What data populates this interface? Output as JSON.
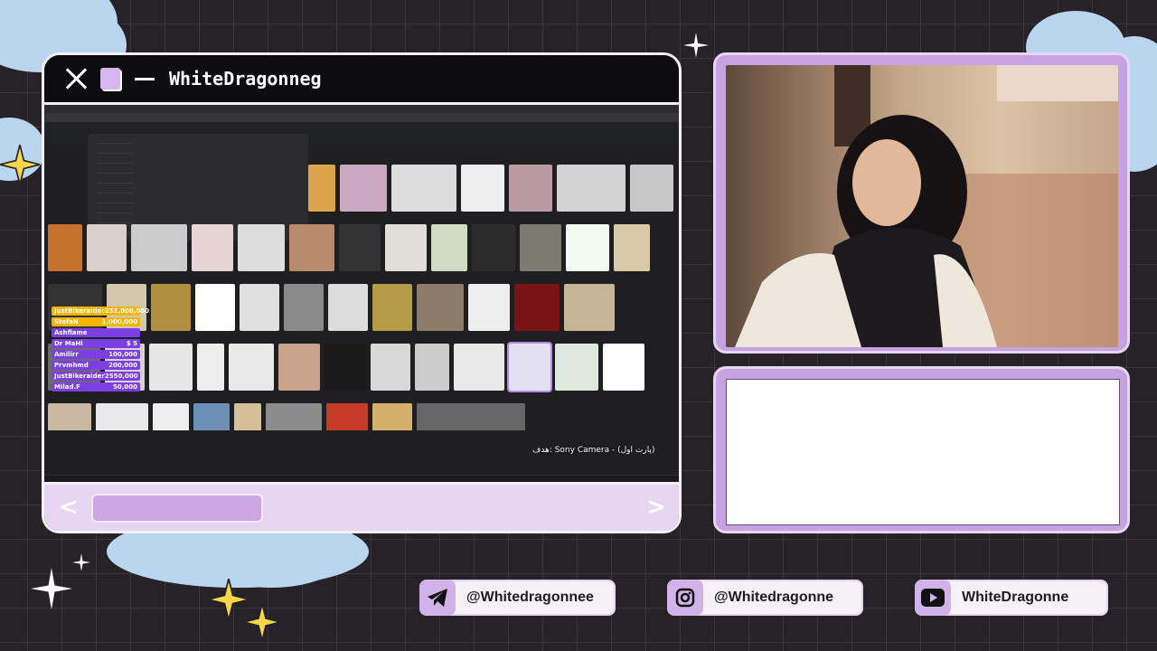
{
  "window": {
    "title": "WhiteDragonneg"
  },
  "alerts": [
    {
      "name": "JustBikeraider25",
      "amount": "1,000,000",
      "color": "#f5b400"
    },
    {
      "name": "StefaN",
      "amount": "1,000,000",
      "color": "#f5b400"
    },
    {
      "name": "Ashflame",
      "amount": "",
      "color": "#7b3fe4"
    },
    {
      "name": "Dr MaHi",
      "amount": "$ 5",
      "color": "#7b3fe4"
    },
    {
      "name": "Amilirr",
      "amount": "100,000",
      "color": "#7b3fe4"
    },
    {
      "name": "Prvmhmd",
      "amount": "200,000",
      "color": "#7b3fe4"
    },
    {
      "name": "JustBikeraider25",
      "amount": "50,000",
      "color": "#7b3fe4"
    },
    {
      "name": "Milad.F",
      "amount": "50,000",
      "color": "#7b3fe4"
    }
  ],
  "caption": "هدف: Sony Camera - (پارت اول)",
  "socials": {
    "telegram": "@Whitedragonnee",
    "instagram": "@Whitedragonne",
    "youtube": "WhiteDragonne"
  },
  "colors": {
    "accent": "#c7a2e0",
    "frame": "#f4f1f6",
    "background": "#262227",
    "cloud": "#b9d6ee",
    "star": "#f7d64a"
  },
  "icons": [
    "close-icon",
    "window-icon",
    "minimize-icon",
    "arrow-left-icon",
    "arrow-right-icon",
    "telegram-icon",
    "instagram-icon",
    "youtube-icon"
  ]
}
